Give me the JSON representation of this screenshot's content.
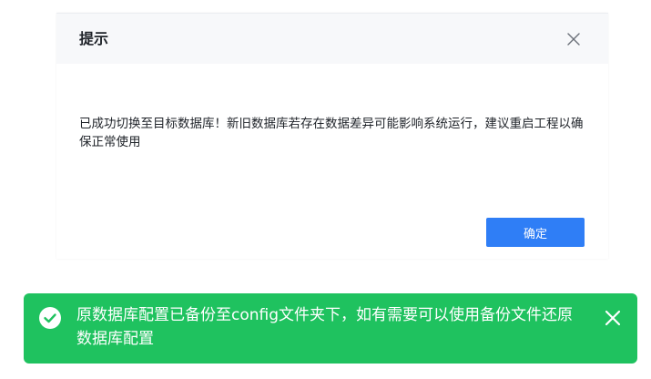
{
  "dialog": {
    "title": "提示",
    "close_icon": "close-icon",
    "message": "已成功切换至目标数据库！新旧数据库若存在数据差异可能影响系统运行，建议重启工程以确保正常使用",
    "confirm_label": "确定"
  },
  "toast": {
    "icon": "check-circle-icon",
    "message": "原数据库配置已备份至config文件夹下，如有需要可以使用备份文件还原数据库配置",
    "close_icon": "close-icon"
  },
  "colors": {
    "primary": "#2f7ef6",
    "success": "#1fc25f",
    "header_bg": "#f7f8fa",
    "text": "#1f2329"
  }
}
